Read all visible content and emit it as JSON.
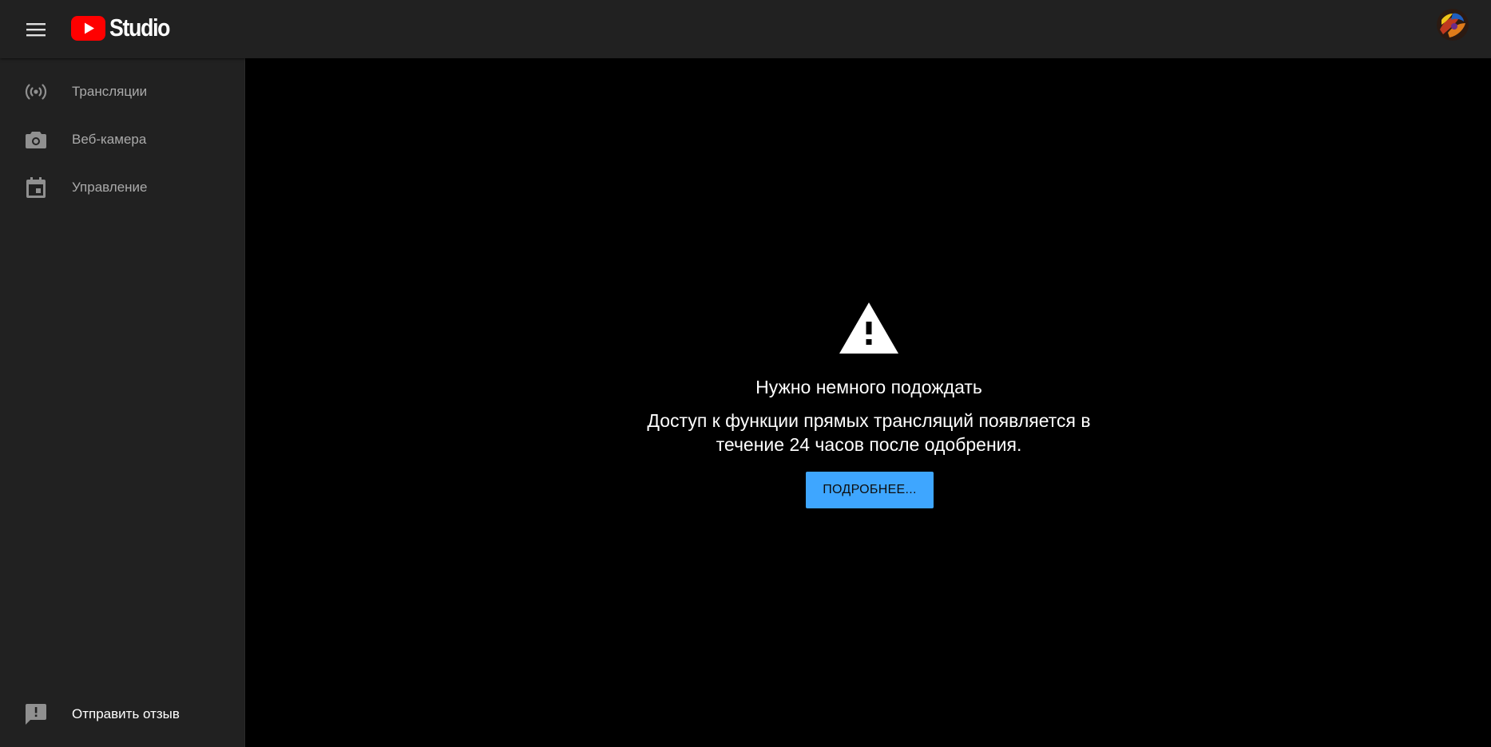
{
  "app": {
    "title": "Studio",
    "brand_red": "#FF0000"
  },
  "topbar": {
    "menu_icon": "hamburger-menu-icon",
    "avatar_icon": "user-avatar"
  },
  "sidebar": {
    "items": [
      {
        "label": "Трансляции",
        "icon": "broadcast-icon"
      },
      {
        "label": "Веб-камера",
        "icon": "camera-icon"
      },
      {
        "label": "Управление",
        "icon": "calendar-icon"
      }
    ],
    "feedback": {
      "label": "Отправить отзыв",
      "icon": "feedback-icon"
    }
  },
  "main": {
    "icon": "warning-icon",
    "title": "Нужно немного подождать",
    "body_line1": "Доступ к функции прямых трансляций появляется в",
    "body_line2": "течение 24 часов после одобрения.",
    "button_label": "ПОДРОБНЕЕ...",
    "button_color": "#3EA6FF"
  }
}
